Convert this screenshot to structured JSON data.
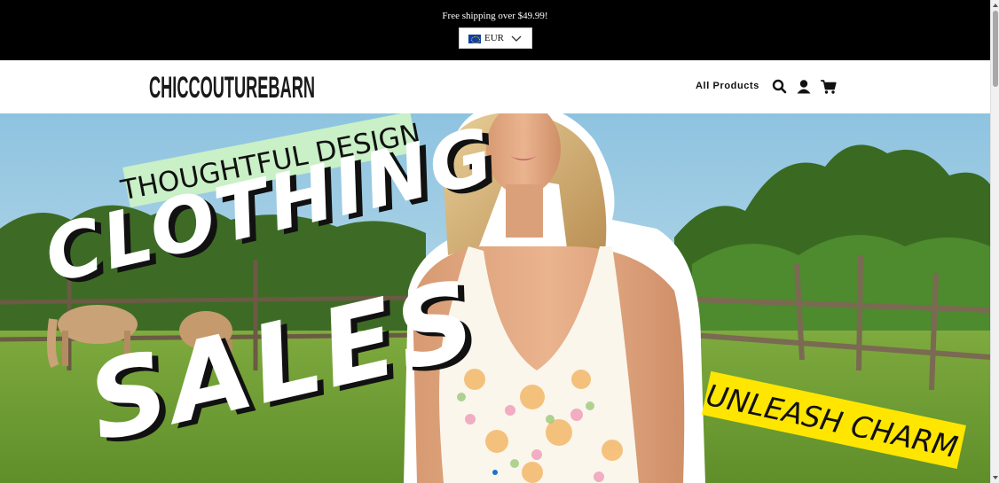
{
  "announcement": {
    "text": "Free shipping over $49.99!",
    "currency": {
      "code": "EUR",
      "icon": "eu-flag-icon"
    }
  },
  "header": {
    "logo_text": "CHICCOUTUREBARN",
    "nav": [
      {
        "label": "All Products"
      }
    ],
    "icons": [
      "search-icon",
      "account-icon",
      "cart-icon"
    ]
  },
  "hero": {
    "tagline_top": "THOUGHTFUL DESIGN",
    "headline_1": "CLOTHING",
    "headline_2": "SALES",
    "tagline_bottom": "UNLEASH CHARM",
    "tagline_bottom_color": "#ffe600",
    "tagline_top_color": "#c9f0c6"
  },
  "slider": {
    "dots": 1
  }
}
